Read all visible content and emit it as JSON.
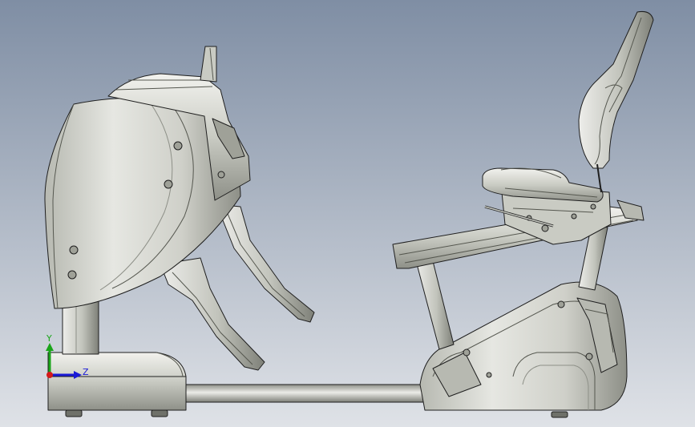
{
  "viewport": {
    "background_top": "#7f8ea4",
    "background_bottom": "#dfe2e7"
  },
  "model": {
    "part_fill": "#d4d5ce",
    "part_shade": "#9fa198",
    "part_dark": "#55574f",
    "edge_color": "#1f1f1f"
  },
  "triad": {
    "y_label": "Y",
    "z_label": "Z",
    "y_color": "#1aa51a",
    "z_color": "#1a1ad6",
    "x_color": "#d41a1a"
  }
}
